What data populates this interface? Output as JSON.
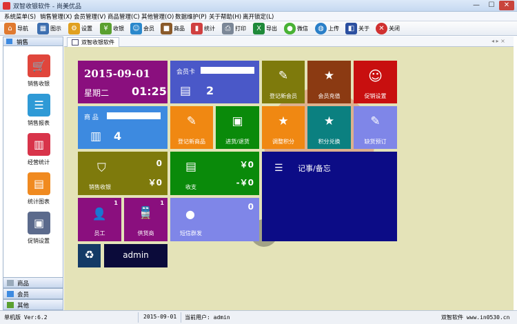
{
  "window": {
    "title": "双智收银软件 - 尚美优品",
    "buttons": [
      "—",
      "☐",
      "✕"
    ]
  },
  "menu": [
    "系统菜单(S)",
    "销售管理(X)",
    "会员管理(V)",
    "商品管理(C)",
    "其他管理(O)",
    "数据维护(P)",
    "关于帮助(H)",
    "离开锁定(L)"
  ],
  "toolbar": [
    {
      "label": "导航",
      "icon": "home-icon",
      "color": "#e07a30"
    },
    {
      "label": "图示",
      "icon": "grid-icon",
      "color": "#3d6fb0"
    },
    {
      "label": "设置",
      "icon": "gear-icon",
      "color": "#e0a020"
    },
    {
      "label": "收银",
      "icon": "yen-icon",
      "color": "#5aa030"
    },
    {
      "label": "会员",
      "icon": "member-icon",
      "color": "#2a88cc"
    },
    {
      "label": "商品",
      "icon": "box-icon",
      "color": "#8a5a2a"
    },
    {
      "label": "统计",
      "icon": "bar-chart-icon",
      "color": "#d04040"
    },
    {
      "label": "打印",
      "icon": "printer-icon",
      "color": "#7b8797"
    },
    {
      "label": "导出",
      "icon": "excel-icon",
      "color": "#1f8a3a"
    },
    {
      "label": "微信",
      "icon": "wechat-icon",
      "color": "#49b235"
    },
    {
      "label": "上传",
      "icon": "globe-icon",
      "color": "#2a7fc8"
    },
    {
      "label": "关于",
      "icon": "about-icon",
      "color": "#2b4fa0"
    },
    {
      "label": "关闭",
      "icon": "close-icon",
      "color": "#d03030"
    }
  ],
  "sidebar": {
    "header": "销售",
    "tiles": [
      {
        "label": "销售收银",
        "icon": "cart-icon",
        "color": "#e0463c"
      },
      {
        "label": "销售报表",
        "icon": "list-icon",
        "color": "#2f9ad6"
      },
      {
        "label": "经营统计",
        "icon": "bar-chart-icon",
        "color": "#d8344a"
      },
      {
        "label": "统计图表",
        "icon": "chart-icon",
        "color": "#f08a20"
      },
      {
        "label": "促销设置",
        "icon": "calendar-icon",
        "color": "#5b6a8c"
      }
    ],
    "sections": [
      "商品",
      "会员",
      "其他"
    ]
  },
  "tab": {
    "label": "双智收银软件",
    "nav": "◂ ▸ ×"
  },
  "tiles": {
    "date": "2015-09-01",
    "weekday": "星期二",
    "time": "01:25",
    "member_card_label": "会员卡",
    "member_count": "2",
    "product_label": "商  品",
    "product_count": "4",
    "register_member": "登记新会员",
    "member_recharge": "会员充值",
    "promo_settings": "促销设置",
    "register_product": "登记新商品",
    "stock_in_out": "进货/退货",
    "adjust_points": "调整积分",
    "points_redeem": "积分兑换",
    "shortage_order": "缺货预订",
    "sales_count": "0",
    "sales_amount": "￥0",
    "sales_caption": "销售收银",
    "income_amount": "￥0",
    "expense_amount": "-￥0",
    "income_caption": "收支",
    "notes_title": "记事/备忘",
    "staff_count": "1",
    "staff_caption": "员工",
    "supplier_count": "1",
    "supplier_caption": "供货商",
    "sms_count": "0",
    "sms_caption": "短信群发",
    "user_name": "admin"
  },
  "status": {
    "version": "单机版 Ver:6.2",
    "date": "2015-09-01",
    "user": "当前用户: admin",
    "brand": "双智软件 www.in0530.cn"
  },
  "colors": {
    "tile_purple": "#8a0f7e",
    "tile_blue": "#4a58c8",
    "tile_olive": "#7e7a0c",
    "tile_brown": "#8b3a12",
    "tile_red": "#c80f0f",
    "tile_orange": "#f08812",
    "tile_green": "#0a8a0a",
    "tile_teal": "#0b8080",
    "tile_navy": "#0c0c86",
    "tile_sky": "#3d8ae0",
    "tile_lavender": "#7f86e8"
  }
}
